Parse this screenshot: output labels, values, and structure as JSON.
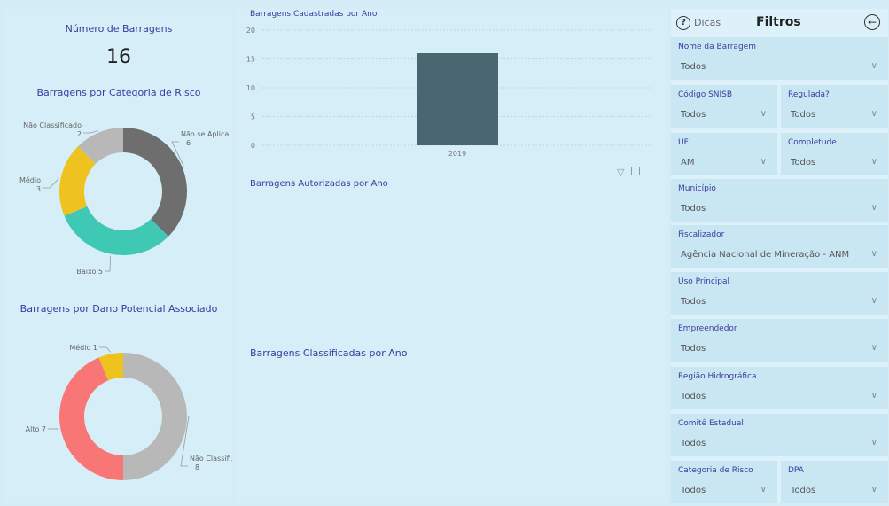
{
  "left": {
    "kpi": {
      "title": "Número de Barragens",
      "value": "16"
    },
    "risk_chart_title": "Barragens por Categoria de Risco",
    "dpa_chart_title": "Barragens por Dano Potencial Associado"
  },
  "middle": {
    "cadastradas_title": "Barragens Cadastradas por Ano",
    "autorizadas_title": "Barragens Autorizadas por Ano",
    "classificadas_title": "Barragens Classificadas por Ano"
  },
  "filters": {
    "dicas_label": "Dicas",
    "title": "Filtros",
    "nome": {
      "label": "Nome da Barragem",
      "value": "Todos"
    },
    "codigo": {
      "label": "Código SNISB",
      "value": "Todos"
    },
    "regulada": {
      "label": "Regulada?",
      "value": "Todos"
    },
    "uf": {
      "label": "UF",
      "value": "AM"
    },
    "completude": {
      "label": "Completude",
      "value": "Todos"
    },
    "municipio": {
      "label": "Município",
      "value": "Todos"
    },
    "fiscalizador": {
      "label": "Fiscalizador",
      "value": "Agência Nacional de Mineração - ANM"
    },
    "uso": {
      "label": "Uso Principal",
      "value": "Todos"
    },
    "empreendedor": {
      "label": "Empreendedor",
      "value": "Todos"
    },
    "regiao": {
      "label": "Região Hidrográfica",
      "value": "Todos"
    },
    "comite": {
      "label": "Comitê Estadual",
      "value": "Todos"
    },
    "categoria": {
      "label": "Categoria de Risco",
      "value": "Todos"
    },
    "dpa": {
      "label": "DPA",
      "value": "Todos"
    }
  },
  "colors": {
    "accent_text": "#3b3b9e",
    "bar": "#4a6671",
    "gray_dark": "#6e6e6e",
    "teal": "#3fc9b5",
    "yellow": "#eec21f",
    "gray_light": "#b8b8b8",
    "salmon": "#f87676"
  },
  "chart_data": [
    {
      "type": "pie",
      "title": "Barragens por Categoria de Risco",
      "labels": [
        "Não se Aplica",
        "Baixo",
        "Médio",
        "Não Classificado"
      ],
      "values": [
        6,
        5,
        3,
        2
      ],
      "label_text": [
        "Não se Aplica\n6",
        "Baixo 5",
        "Médio\n3",
        "Não Classificado\n2"
      ],
      "colors": [
        "#6e6e6e",
        "#3fc9b5",
        "#eec21f",
        "#b8b8b8"
      ]
    },
    {
      "type": "pie",
      "title": "Barragens por Dano Potencial Associado",
      "labels": [
        "Não Classifi...",
        "Alto",
        "Médio"
      ],
      "values": [
        8,
        7,
        1
      ],
      "label_text": [
        "Não Classifi...\n8",
        "Alto 7",
        "Médio 1"
      ],
      "colors": [
        "#b8b8b8",
        "#f87676",
        "#eec21f"
      ]
    },
    {
      "type": "bar",
      "title": "Barragens Cadastradas por Ano",
      "categories": [
        "2019"
      ],
      "values": [
        16
      ],
      "ylim": [
        0,
        20
      ],
      "yticks": [
        0,
        5,
        10,
        15,
        20
      ],
      "grid": true
    }
  ]
}
